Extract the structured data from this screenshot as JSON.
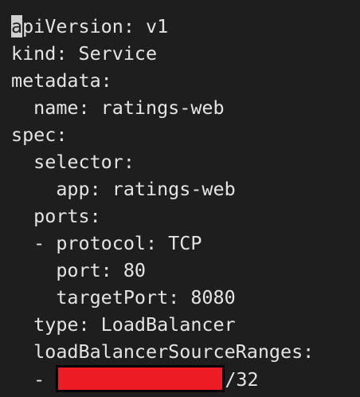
{
  "editor": {
    "lines": [
      {
        "indent": "",
        "cursor": "a",
        "text": "piVersion: v1"
      },
      {
        "indent": "",
        "text": "kind: Service"
      },
      {
        "indent": "",
        "text": "metadata:"
      },
      {
        "indent": "  ",
        "text": "name: ratings-web"
      },
      {
        "indent": "",
        "text": "spec:"
      },
      {
        "indent": "  ",
        "text": "selector:"
      },
      {
        "indent": "    ",
        "text": "app: ratings-web"
      },
      {
        "indent": "  ",
        "text": "ports:"
      },
      {
        "indent": "  ",
        "text": "- protocol: TCP"
      },
      {
        "indent": "    ",
        "text": "port: 80"
      },
      {
        "indent": "    ",
        "text": "targetPort: 8080"
      },
      {
        "indent": "  ",
        "text": "type: LoadBalancer"
      },
      {
        "indent": "  ",
        "text": "loadBalancerSourceRanges:"
      },
      {
        "indent": "  ",
        "prefix": "- ",
        "redacted": true,
        "suffix": "/32"
      }
    ],
    "colors": {
      "background": "#1e1e1e",
      "text": "#e4e4e4",
      "cursor": "#cfcfcf",
      "redaction": "#ed1c24"
    }
  }
}
